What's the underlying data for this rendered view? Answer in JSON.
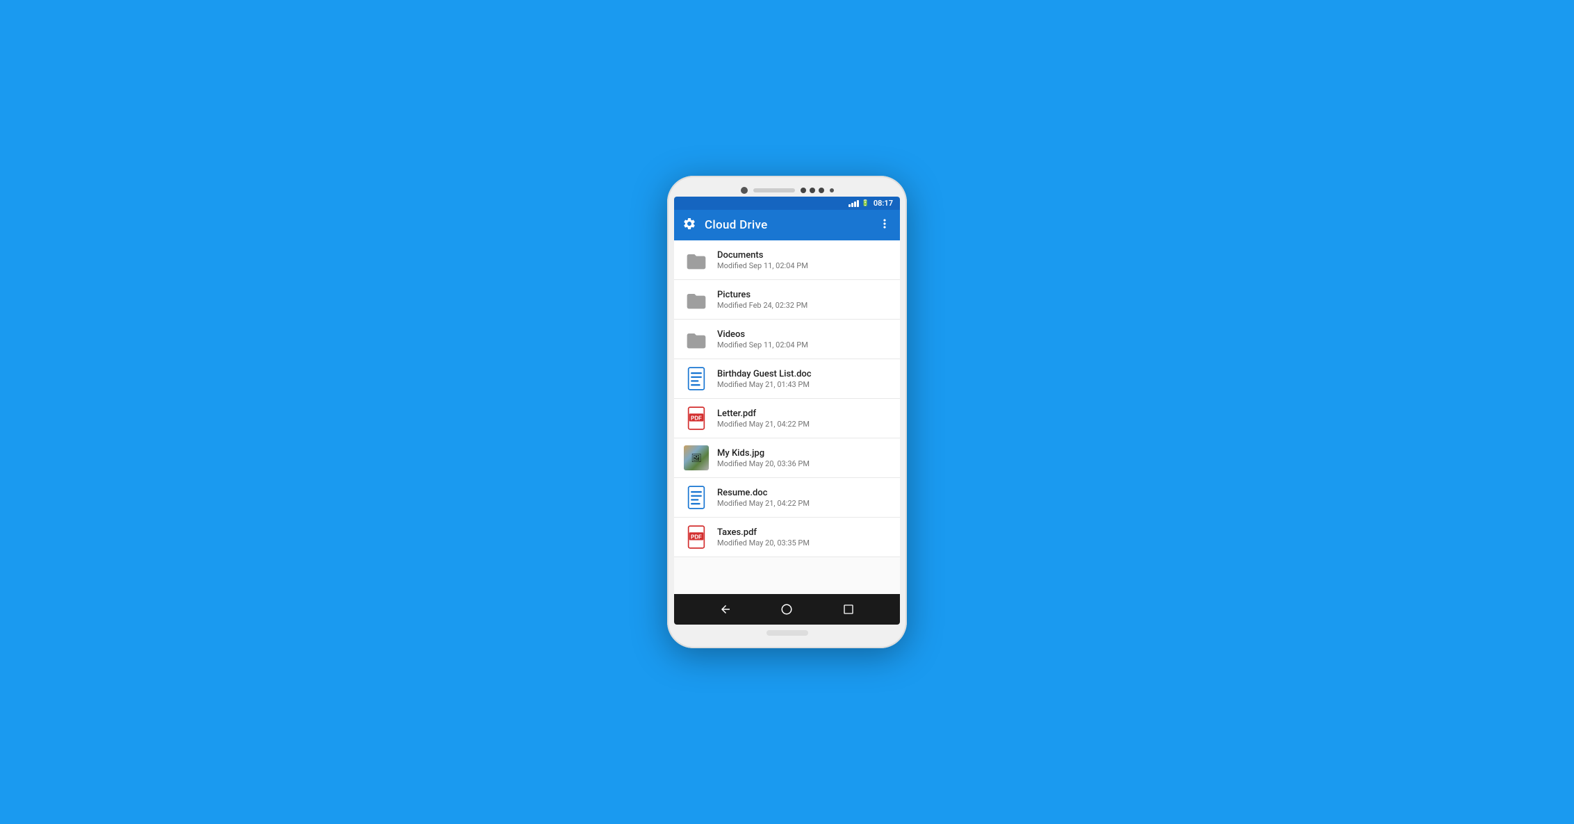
{
  "background_color": "#1a9af0",
  "status_bar": {
    "time": "08:17",
    "battery_icon": "🔋"
  },
  "app_bar": {
    "title": "Cloud Drive",
    "settings_icon": "settings-icon",
    "more_icon": "more-icon"
  },
  "files": [
    {
      "id": "documents",
      "name": "Documents",
      "modified": "Modified Sep 11, 02:04 PM",
      "type": "folder"
    },
    {
      "id": "pictures",
      "name": "Pictures",
      "modified": "Modified Feb 24, 02:32 PM",
      "type": "folder"
    },
    {
      "id": "videos",
      "name": "Videos",
      "modified": "Modified Sep 11, 02:04 PM",
      "type": "folder"
    },
    {
      "id": "birthday-guest-list",
      "name": "Birthday Guest List.doc",
      "modified": "Modified May 21, 01:43 PM",
      "type": "doc"
    },
    {
      "id": "letter-pdf",
      "name": "Letter.pdf",
      "modified": "Modified May 21, 04:22 PM",
      "type": "pdf"
    },
    {
      "id": "my-kids-jpg",
      "name": "My Kids.jpg",
      "modified": "Modified May 20, 03:36 PM",
      "type": "image"
    },
    {
      "id": "resume-doc",
      "name": "Resume.doc",
      "modified": "Modified May 21, 04:22 PM",
      "type": "doc"
    },
    {
      "id": "taxes-pdf",
      "name": "Taxes.pdf",
      "modified": "Modified May 20, 03:35 PM",
      "type": "pdf"
    }
  ],
  "nav_bar": {
    "back_label": "◁",
    "home_label": "○",
    "recent_label": "□"
  }
}
